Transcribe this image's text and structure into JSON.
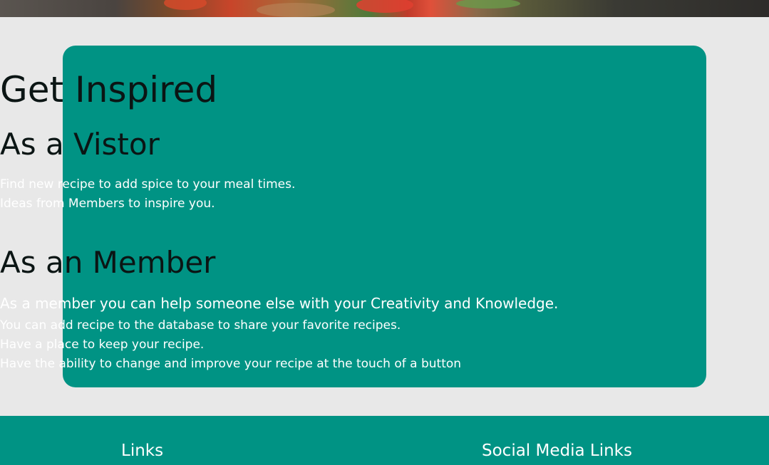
{
  "hero": {
    "image": "food-photo"
  },
  "inspire": {
    "title": "Get Inspired",
    "visitor": {
      "heading": "As a Vistor",
      "lines": [
        "Find new recipe to add spice to your meal times.",
        "Ideas from Members to inspire you."
      ]
    },
    "member": {
      "heading": "As an Member",
      "lead": "As a member you can help someone else with your Creativity and Knowledge.",
      "lines": [
        "You can add recipe to the database to share your favorite recipes.",
        "Have a place to keep your recipe.",
        "Have the ability to change and improve your recipe at the touch of a button"
      ]
    }
  },
  "footer": {
    "links_title": "Links",
    "social_title": "Social Media Links"
  },
  "colors": {
    "accent": "#009384",
    "page_bg": "#e8e8e8",
    "heading_text": "#0b1514",
    "body_text": "#ffffff"
  }
}
